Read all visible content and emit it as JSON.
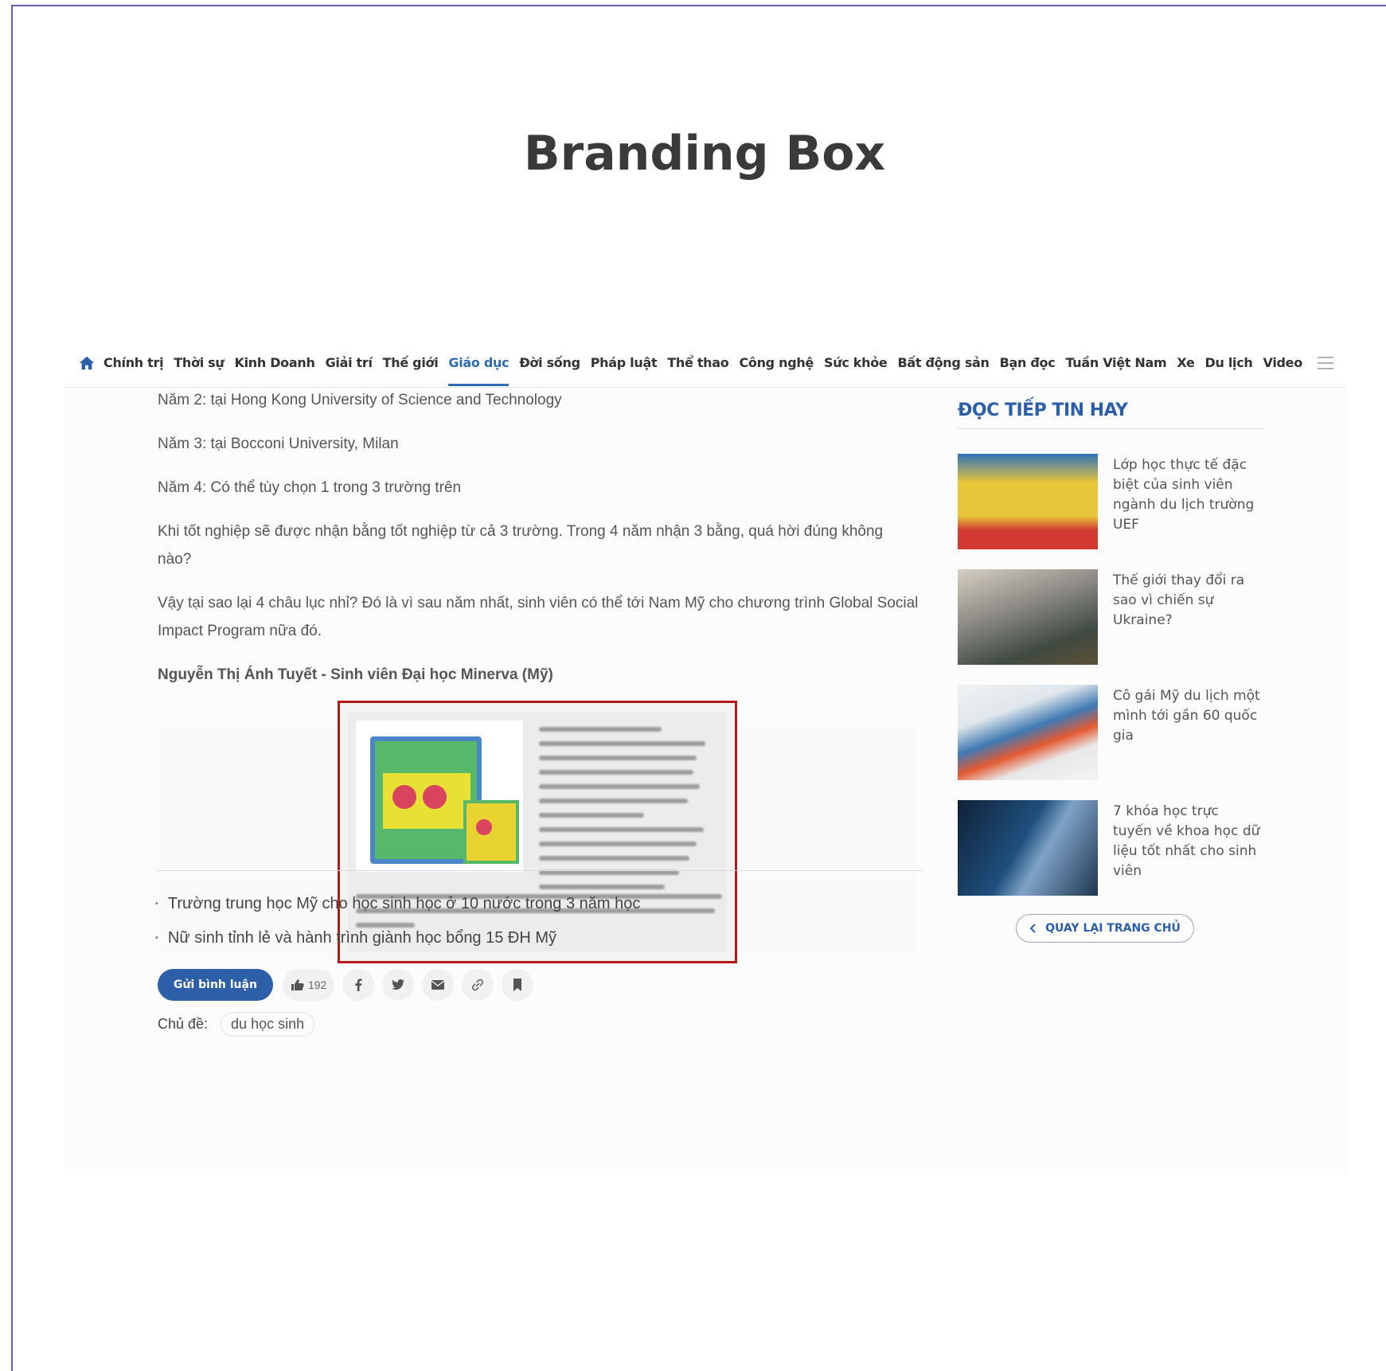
{
  "slide": {
    "title": "Branding Box"
  },
  "nav": {
    "items": [
      "Chính trị",
      "Thời sự",
      "Kinh Doanh",
      "Giải trí",
      "Thế giới",
      "Giáo dục",
      "Đời sống",
      "Pháp luật",
      "Thể thao",
      "Công nghệ",
      "Sức khỏe",
      "Bất động sản",
      "Bạn đọc",
      "Tuần Việt Nam",
      "Xe",
      "Du lịch",
      "Video"
    ],
    "active": "Giáo dục"
  },
  "article": {
    "paragraphs": [
      "Năm 2: tại Hong Kong University of Science and Technology",
      "Năm 3: tại Bocconi University, Milan",
      "Năm 4: Có thể tùy chọn 1 trong 3 trường trên",
      "Khi tốt nghiệp sẽ được nhận bằng tốt nghiệp từ cả 3 trường. Trong 4 năm nhận 3 bằng, quá hời đúng không nào?",
      "Vậy tại sao lại 4 châu lục nhỉ? Đó là vì sau năm nhất, sinh viên có thể tới Nam Mỹ cho chương trình Global Social Impact Program nữa đó."
    ],
    "author": "Nguyễn Thị Ánh Tuyết - Sinh viên Đại học Minerva (Mỹ)"
  },
  "related": [
    "Trường trung học Mỹ cho học sinh học ở 10 nước trong 3 năm học",
    "Nữ sinh tỉnh lẻ và hành trình giành học bổng 15 ĐH Mỹ"
  ],
  "actions": {
    "comment_label": "Gửi bình luận",
    "likes": "192"
  },
  "topics": {
    "label": "Chủ đề:",
    "tag": "du học sinh"
  },
  "sidebar": {
    "title": "ĐỌC TIẾP TIN HAY",
    "cards": [
      "Lớp học thực tế đặc biệt của sinh viên ngành du lịch trường UEF",
      "Thế giới thay đổi ra sao vì chiến sự Ukraine?",
      "Cô gái Mỹ du lịch một mình tới gần 60 quốc gia",
      "7 khóa học trực tuyến về khoa học dữ liệu tốt nhất cho sinh viên"
    ],
    "back_label": "QUAY LẠI TRANG CHỦ"
  },
  "colors": {
    "accent": "#2d5fa8",
    "highlight_border": "#b01c1c"
  }
}
